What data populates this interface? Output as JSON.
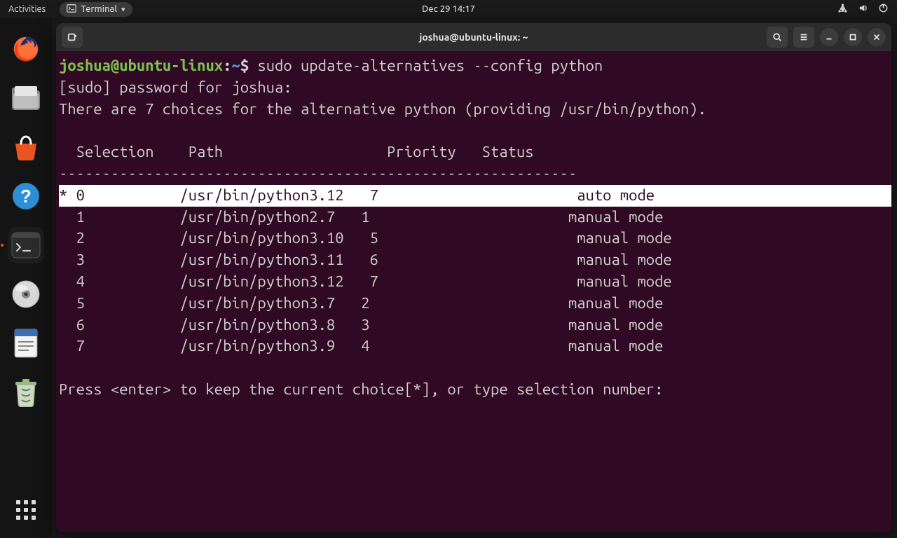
{
  "panel": {
    "activities": "Activities",
    "app_indicator": "Terminal",
    "clock": "Dec 29  14:17"
  },
  "titlebar": {
    "title": "joshua@ubuntu-linux: ~"
  },
  "prompt": {
    "user_host": "joshua@ubuntu-linux",
    "path": "~",
    "command": "sudo update-alternatives --config python"
  },
  "output": {
    "sudo_line": "[sudo] password for joshua: ",
    "info_line": "There are 7 choices for the alternative python (providing /usr/bin/python).",
    "header": "  Selection    Path                   Priority   Status",
    "separator": "------------------------------------------------------------",
    "rows": [
      {
        "mark": "*",
        "sel": "0",
        "path": "/usr/bin/python3.12",
        "prio": "7",
        "status": "auto mode"
      },
      {
        "mark": " ",
        "sel": "1",
        "path": "/usr/bin/python2.7",
        "prio": "1",
        "status": "manual mode"
      },
      {
        "mark": " ",
        "sel": "2",
        "path": "/usr/bin/python3.10",
        "prio": "5",
        "status": "manual mode"
      },
      {
        "mark": " ",
        "sel": "3",
        "path": "/usr/bin/python3.11",
        "prio": "6",
        "status": "manual mode"
      },
      {
        "mark": " ",
        "sel": "4",
        "path": "/usr/bin/python3.12",
        "prio": "7",
        "status": "manual mode"
      },
      {
        "mark": " ",
        "sel": "5",
        "path": "/usr/bin/python3.7",
        "prio": "2",
        "status": "manual mode"
      },
      {
        "mark": " ",
        "sel": "6",
        "path": "/usr/bin/python3.8",
        "prio": "3",
        "status": "manual mode"
      },
      {
        "mark": " ",
        "sel": "7",
        "path": "/usr/bin/python3.9",
        "prio": "4",
        "status": "manual mode"
      }
    ],
    "footer": "Press <enter> to keep the current choice[*], or type selection number: "
  },
  "layout": {
    "col_sel": 2,
    "col_path": 17,
    "col_prio": 24,
    "col_status": 13
  }
}
